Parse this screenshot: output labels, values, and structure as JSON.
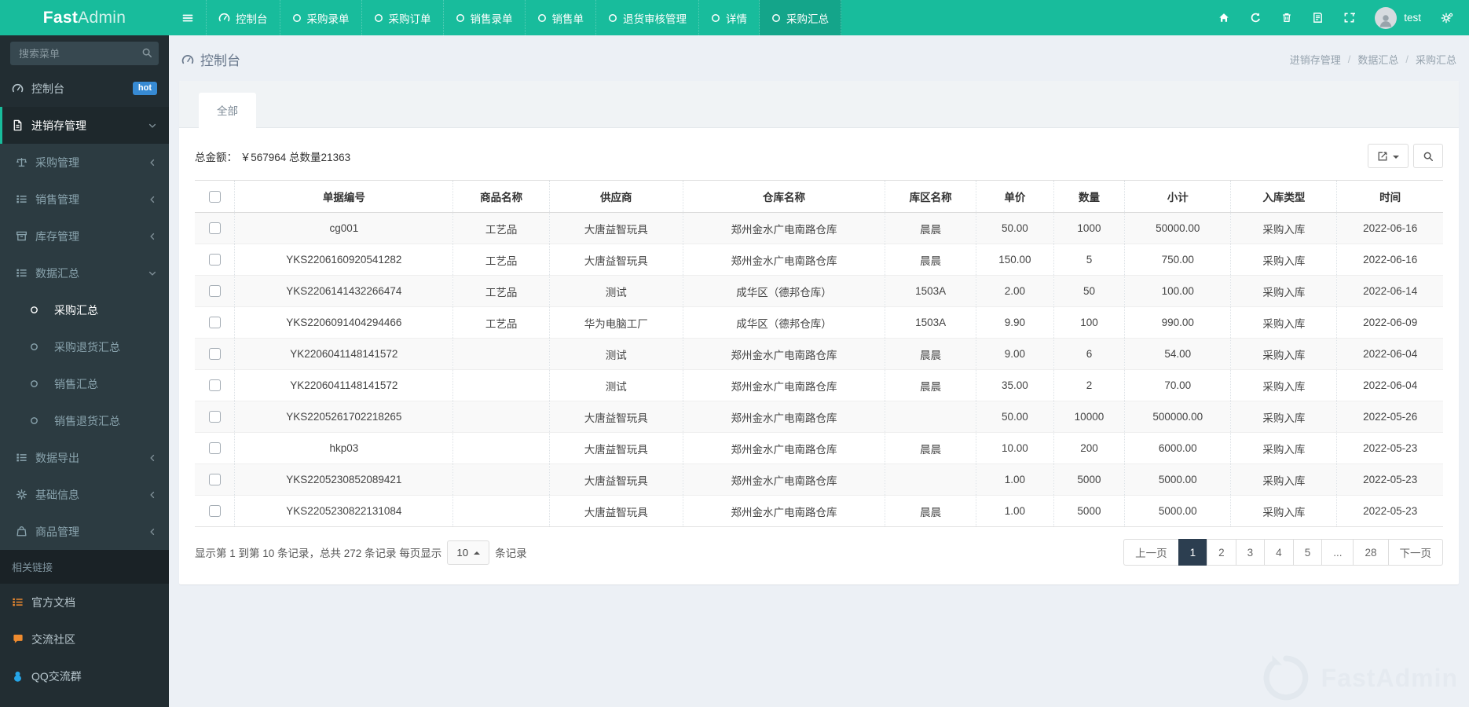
{
  "brand": {
    "bold": "Fast",
    "light": "Admin"
  },
  "topbar": {
    "tabs": [
      {
        "label": "控制台"
      },
      {
        "label": "采购录单"
      },
      {
        "label": "采购订单"
      },
      {
        "label": "销售录单"
      },
      {
        "label": "销售单"
      },
      {
        "label": "退货审核管理"
      },
      {
        "label": "详情"
      },
      {
        "label": "采购汇总"
      }
    ],
    "username": "test"
  },
  "sidebar": {
    "search_placeholder": "搜索菜单",
    "dashboard": {
      "label": "控制台",
      "badge": "hot"
    },
    "root": {
      "label": "进销存管理"
    },
    "submenu": [
      {
        "label": "采购管理"
      },
      {
        "label": "销售管理"
      },
      {
        "label": "库存管理"
      },
      {
        "label": "数据汇总"
      },
      {
        "label": "数据导出"
      },
      {
        "label": "基础信息"
      },
      {
        "label": "商品管理"
      }
    ],
    "summary_children": [
      {
        "label": "采购汇总"
      },
      {
        "label": "采购退货汇总"
      },
      {
        "label": "销售汇总"
      },
      {
        "label": "销售退货汇总"
      }
    ],
    "section_header": "相关链接",
    "links": [
      {
        "label": "官方文档"
      },
      {
        "label": "交流社区"
      },
      {
        "label": "QQ交流群"
      }
    ]
  },
  "content": {
    "page_title": "控制台",
    "breadcrumb": [
      "进销存管理",
      "数据汇总",
      "采购汇总"
    ],
    "breadcrumb_separator": "/",
    "panel_tab": "全部",
    "summary": "总金额： ￥567964 总数量21363"
  },
  "table": {
    "columns": [
      "单据编号",
      "商品名称",
      "供应商",
      "仓库名称",
      "库区名称",
      "单价",
      "数量",
      "小计",
      "入库类型",
      "时间"
    ],
    "rows": [
      [
        "cg001",
        "工艺品",
        "大唐益智玩具",
        "郑州金水广电南路仓库",
        "晨晨",
        "50.00",
        "1000",
        "50000.00",
        "采购入库",
        "2022-06-16"
      ],
      [
        "YKS2206160920541282",
        "工艺品",
        "大唐益智玩具",
        "郑州金水广电南路仓库",
        "晨晨",
        "150.00",
        "5",
        "750.00",
        "采购入库",
        "2022-06-16"
      ],
      [
        "YKS2206141432266474",
        "工艺品",
        "测试",
        "成华区（德邦仓库）",
        "1503A",
        "2.00",
        "50",
        "100.00",
        "采购入库",
        "2022-06-14"
      ],
      [
        "YKS2206091404294466",
        "工艺品",
        "华为电脑工厂",
        "成华区（德邦仓库）",
        "1503A",
        "9.90",
        "100",
        "990.00",
        "采购入库",
        "2022-06-09"
      ],
      [
        "YK2206041148141572",
        "",
        "测试",
        "郑州金水广电南路仓库",
        "晨晨",
        "9.00",
        "6",
        "54.00",
        "采购入库",
        "2022-06-04"
      ],
      [
        "YK2206041148141572",
        "",
        "测试",
        "郑州金水广电南路仓库",
        "晨晨",
        "35.00",
        "2",
        "70.00",
        "采购入库",
        "2022-06-04"
      ],
      [
        "YKS2205261702218265",
        "",
        "大唐益智玩具",
        "郑州金水广电南路仓库",
        "",
        "50.00",
        "10000",
        "500000.00",
        "采购入库",
        "2022-05-26"
      ],
      [
        "hkp03",
        "",
        "大唐益智玩具",
        "郑州金水广电南路仓库",
        "晨晨",
        "10.00",
        "200",
        "6000.00",
        "采购入库",
        "2022-05-23"
      ],
      [
        "YKS2205230852089421",
        "",
        "大唐益智玩具",
        "郑州金水广电南路仓库",
        "",
        "1.00",
        "5000",
        "5000.00",
        "采购入库",
        "2022-05-23"
      ],
      [
        "YKS2205230822131084",
        "",
        "大唐益智玩具",
        "郑州金水广电南路仓库",
        "晨晨",
        "1.00",
        "5000",
        "5000.00",
        "采购入库",
        "2022-05-23"
      ]
    ]
  },
  "footer": {
    "info_before": "显示第 1 到第 10 条记录，总共 272 条记录 每页显示",
    "page_size": "10",
    "info_after": "条记录",
    "pages": [
      "上一页",
      "1",
      "2",
      "3",
      "4",
      "5",
      "...",
      "28",
      "下一页"
    ],
    "active_page": "1"
  },
  "colors": {
    "accent_green": "#18bc9c",
    "active_tab_green": "#14a58a",
    "sidebar_bg": "#222d32",
    "submenu_bg": "#2c3b41",
    "badge_blue": "#378ad3",
    "pagination_active": "#2c3e50",
    "content_bg": "#ecf0f5"
  }
}
